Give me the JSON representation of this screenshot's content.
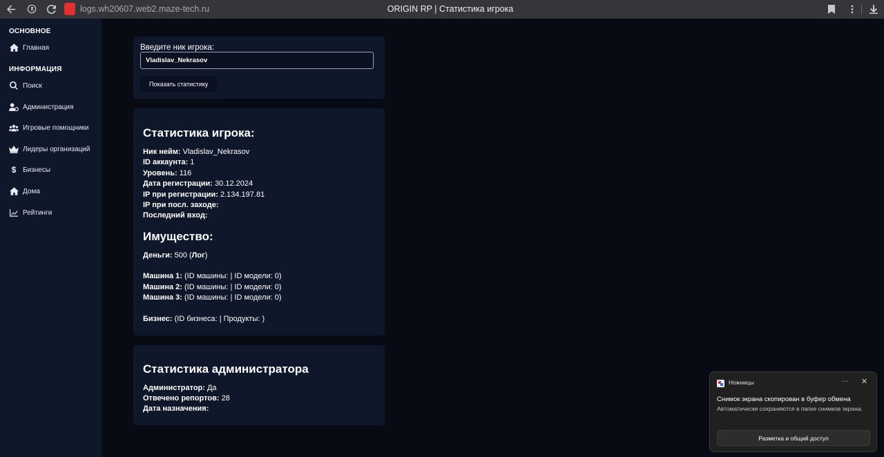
{
  "browser": {
    "url": "logs.wh20607.web2.maze-tech.ru",
    "title": "ORIGIN RP | Статистика игрока"
  },
  "sidebar": {
    "section_main": "ОСНОВНОЕ",
    "main_items": [
      {
        "label": "Главная",
        "icon": "home-icon"
      }
    ],
    "section_info": "ИНФОРМАЦИЯ",
    "info_items": [
      {
        "label": "Поиск",
        "icon": "search-icon"
      },
      {
        "label": "Администрация",
        "icon": "user-gear-icon"
      },
      {
        "label": "Игровые помощники",
        "icon": "users-icon"
      },
      {
        "label": "Лидеры организаций",
        "icon": "crown-icon"
      },
      {
        "label": "Бизнесы",
        "icon": "dollar-icon"
      },
      {
        "label": "Дома",
        "icon": "house-icon"
      },
      {
        "label": "Рейтинги",
        "icon": "chart-line-icon"
      }
    ]
  },
  "search": {
    "label": "Введите ник игрока:",
    "value": "Vladislav_Nekrasov",
    "button": "Показать статистику"
  },
  "stats": {
    "title": "Статистика игрока:",
    "rows": [
      {
        "label": "Ник нейм:",
        "value": "Vladislav_Nekrasov"
      },
      {
        "label": "ID аккаунта:",
        "value": "1"
      },
      {
        "label": "Уровень:",
        "value": "116"
      },
      {
        "label": "Дата регистрации:",
        "value": "30.12.2024"
      },
      {
        "label": "IP при регистрации:",
        "value": "2.134.197.81"
      },
      {
        "label": "IP при посл. заходе:",
        "value": ""
      },
      {
        "label": "Последний вход:",
        "value": ""
      }
    ]
  },
  "property": {
    "title": "Имущество:",
    "money_label": "Деньги:",
    "money_value": "500 (",
    "money_log": "Лог",
    "money_close": ")",
    "cars": [
      {
        "label": "Машина 1:",
        "value": "(ID машины: | ID модели: 0)"
      },
      {
        "label": "Машина 2:",
        "value": "(ID машины: | ID модели: 0)"
      },
      {
        "label": "Машина 3:",
        "value": "(ID машины: | ID модели: 0)"
      }
    ],
    "business_label": "Бизнес:",
    "business_value": "(ID бизнеса: | Продукты: )"
  },
  "admin": {
    "title": "Статистика администратора",
    "rows": [
      {
        "label": "Администратор:",
        "value": "Да"
      },
      {
        "label": "Отвечено репортов:",
        "value": "28"
      },
      {
        "label": "Дата назначения:",
        "value": ""
      }
    ]
  },
  "toast": {
    "app": "Ножницы",
    "more": "···",
    "close": "✕",
    "title": "Снимок экрана скопирован в буфер обмена",
    "body": "Автоматически сохраняются в папке снимков экрана.",
    "button": "Разметка и общий доступ"
  }
}
